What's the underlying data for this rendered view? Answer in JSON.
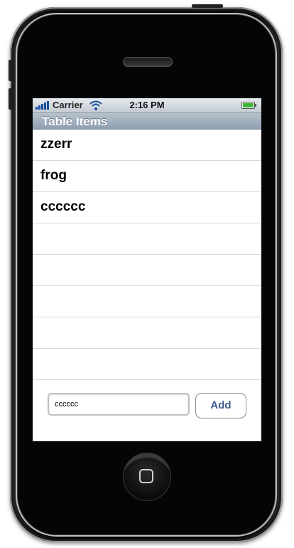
{
  "status_bar": {
    "carrier": "Carrier",
    "time": "2:16 PM",
    "icons": [
      "signal-icon",
      "wifi-icon",
      "battery-icon"
    ]
  },
  "nav_bar": {
    "title": "Table Items"
  },
  "table": {
    "items": [
      {
        "label": "zzerr"
      },
      {
        "label": "frog"
      },
      {
        "label": "cccccc"
      },
      {
        "label": ""
      },
      {
        "label": ""
      },
      {
        "label": ""
      },
      {
        "label": ""
      },
      {
        "label": ""
      }
    ]
  },
  "input": {
    "value": "cccccc"
  },
  "add_button": {
    "label": "Add"
  },
  "colors": {
    "nav_bar": "#9aa9b8",
    "button_text": "#3c5a8d"
  }
}
